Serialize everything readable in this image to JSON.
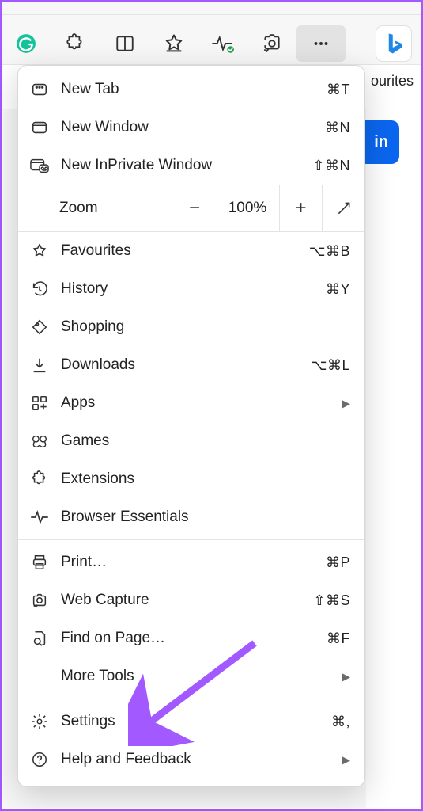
{
  "toolbar": {
    "icons": [
      "grammarly",
      "puzzle",
      "sidebar",
      "favourite-star",
      "health",
      "screenshot",
      "more"
    ],
    "bing_icon": "bing"
  },
  "peek": {
    "right_label": "ourites",
    "signin_fragment": "in"
  },
  "menu": {
    "new_tab": {
      "label": "New Tab",
      "shortcut": "⌘T"
    },
    "new_window": {
      "label": "New Window",
      "shortcut": "⌘N"
    },
    "new_inprivate": {
      "label": "New InPrivate Window",
      "shortcut": "⇧⌘N"
    },
    "zoom": {
      "label": "Zoom",
      "value": "100%"
    },
    "favourites": {
      "label": "Favourites",
      "shortcut": "⌥⌘B"
    },
    "history": {
      "label": "History",
      "shortcut": "⌘Y"
    },
    "shopping": {
      "label": "Shopping"
    },
    "downloads": {
      "label": "Downloads",
      "shortcut": "⌥⌘L"
    },
    "apps": {
      "label": "Apps"
    },
    "games": {
      "label": "Games"
    },
    "extensions": {
      "label": "Extensions"
    },
    "essentials": {
      "label": "Browser Essentials"
    },
    "print": {
      "label": "Print…",
      "shortcut": "⌘P"
    },
    "web_capture": {
      "label": "Web Capture",
      "shortcut": "⇧⌘S"
    },
    "find": {
      "label": "Find on Page…",
      "shortcut": "⌘F"
    },
    "more_tools": {
      "label": "More Tools"
    },
    "settings": {
      "label": "Settings",
      "shortcut": "⌘,"
    },
    "help": {
      "label": "Help and Feedback"
    }
  }
}
